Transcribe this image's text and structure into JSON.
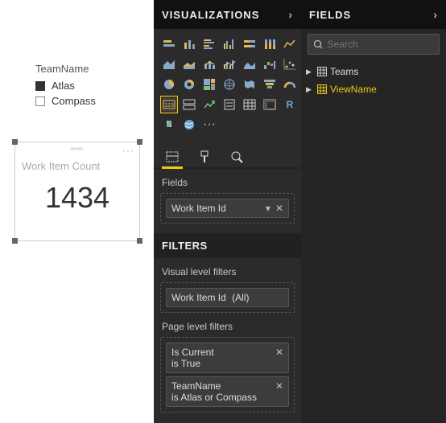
{
  "canvas": {
    "legend": {
      "title": "TeamName",
      "items": [
        {
          "label": "Atlas",
          "checked": true
        },
        {
          "label": "Compass",
          "checked": false
        }
      ]
    },
    "card": {
      "label": "Work Item Count",
      "value": "1434"
    }
  },
  "visualizations": {
    "header": "VISUALIZATIONS",
    "fields_label": "Fields",
    "field_pill": "Work Item Id",
    "filters_header": "FILTERS",
    "visual_filters_label": "Visual level filters",
    "visual_filters": [
      {
        "name": "Work Item Id",
        "summary": "(All)"
      }
    ],
    "page_filters_label": "Page level filters",
    "page_filters": [
      {
        "name": "Is Current",
        "summary": "is True"
      },
      {
        "name": "TeamName",
        "summary": "is Atlas or Compass"
      }
    ]
  },
  "fields": {
    "header": "FIELDS",
    "search_placeholder": "Search",
    "tables": [
      {
        "name": "Teams",
        "selected": false
      },
      {
        "name": "ViewName",
        "selected": true
      }
    ]
  }
}
